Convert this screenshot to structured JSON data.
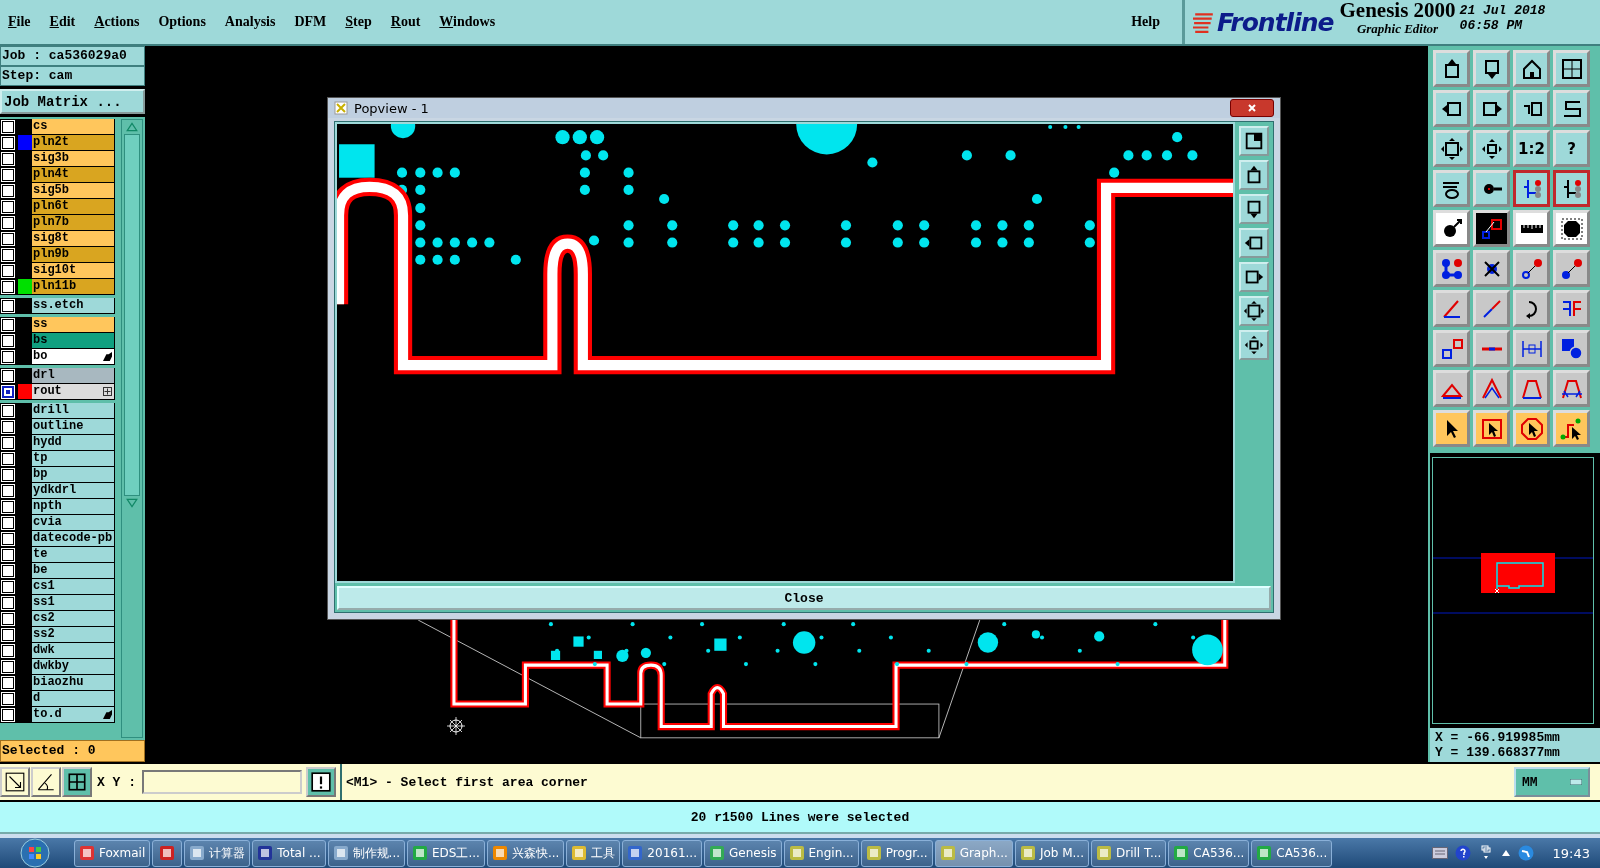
{
  "menu": [
    {
      "label": "File",
      "mnemonic": true
    },
    {
      "label": "Edit",
      "mnemonic": true
    },
    {
      "label": "Actions",
      "mnemonic": true
    },
    {
      "label": "Options",
      "mnemonic": false
    },
    {
      "label": "Analysis",
      "mnemonic": false
    },
    {
      "label": "DFM",
      "mnemonic": false
    },
    {
      "label": "Step",
      "mnemonic": true
    },
    {
      "label": "Rout",
      "mnemonic": true
    },
    {
      "label": "Windows",
      "mnemonic": true
    }
  ],
  "help": "Help",
  "logo": {
    "brand": "Frontline",
    "product": "Genesis 2000",
    "subtitle": "Graphic Editor",
    "date": "21 Jul 2018",
    "time": "06:58 PM"
  },
  "job": "Job : ca536029a0",
  "step": "Step: cam",
  "job_matrix": "Job Matrix ...",
  "layer_groups": [
    [
      {
        "name": "cs",
        "kind": "signal",
        "selected": false,
        "flagged": false,
        "expandable": false
      },
      {
        "name": "pln2t",
        "kind": "plane",
        "color": "#0000ff",
        "selected": false,
        "flagged": false,
        "expandable": false
      },
      {
        "name": "sig3b",
        "kind": "signal",
        "selected": false,
        "flagged": false,
        "expandable": false
      },
      {
        "name": "pln4t",
        "kind": "plane",
        "selected": false,
        "flagged": false,
        "expandable": false
      },
      {
        "name": "sig5b",
        "kind": "signal",
        "selected": false,
        "flagged": false,
        "expandable": false
      },
      {
        "name": "pln6t",
        "kind": "plane",
        "selected": false,
        "flagged": false,
        "expandable": false
      },
      {
        "name": "pln7b",
        "kind": "plane",
        "selected": false,
        "flagged": false,
        "expandable": false
      },
      {
        "name": "sig8t",
        "kind": "signal",
        "selected": false,
        "flagged": false,
        "expandable": false
      },
      {
        "name": "pln9b",
        "kind": "plane",
        "selected": false,
        "flagged": false,
        "expandable": false
      },
      {
        "name": "sig10t",
        "kind": "signal",
        "selected": false,
        "flagged": false,
        "expandable": false
      },
      {
        "name": "pln11b",
        "kind": "plane",
        "color": "#00e000",
        "selected": false,
        "flagged": false,
        "expandable": false
      }
    ],
    [
      {
        "name": "ss.etch",
        "kind": "document",
        "selected": false,
        "flagged": false,
        "expandable": false
      }
    ],
    [
      {
        "name": "ss",
        "kind": "signal",
        "selected": false,
        "flagged": false,
        "expandable": false
      },
      {
        "name": "bs",
        "kind": "mask",
        "selected": false,
        "flagged": false,
        "expandable": false
      },
      {
        "name": "bo",
        "kind": "board",
        "selected": false,
        "flagged": true,
        "expandable": false
      }
    ],
    [
      {
        "name": "drl",
        "kind": "drill",
        "selected": false,
        "flagged": false,
        "expandable": false
      },
      {
        "name": "rout",
        "kind": "rout",
        "color": "#ff0000",
        "selected": true,
        "flagged": false,
        "expandable": true
      }
    ],
    [
      {
        "name": "drill",
        "kind": "document",
        "selected": false,
        "flagged": false,
        "expandable": false
      },
      {
        "name": "outline",
        "kind": "document",
        "selected": false,
        "flagged": false,
        "expandable": false
      },
      {
        "name": "hydd",
        "kind": "document",
        "selected": false,
        "flagged": false,
        "expandable": false
      },
      {
        "name": "tp",
        "kind": "document",
        "selected": false,
        "flagged": false,
        "expandable": false
      },
      {
        "name": "bp",
        "kind": "document",
        "selected": false,
        "flagged": false,
        "expandable": false
      },
      {
        "name": "ydkdrl",
        "kind": "document",
        "selected": false,
        "flagged": false,
        "expandable": false
      },
      {
        "name": "npth",
        "kind": "document",
        "selected": false,
        "flagged": false,
        "expandable": false
      },
      {
        "name": "cvia",
        "kind": "document",
        "selected": false,
        "flagged": false,
        "expandable": false
      },
      {
        "name": "datecode-pb",
        "kind": "document",
        "selected": false,
        "flagged": false,
        "expandable": false
      },
      {
        "name": "te",
        "kind": "document",
        "selected": false,
        "flagged": false,
        "expandable": false
      },
      {
        "name": "be",
        "kind": "document",
        "selected": false,
        "flagged": false,
        "expandable": false
      },
      {
        "name": "cs1",
        "kind": "document",
        "selected": false,
        "flagged": false,
        "expandable": false
      },
      {
        "name": "ss1",
        "kind": "document",
        "selected": false,
        "flagged": false,
        "expandable": false
      },
      {
        "name": "cs2",
        "kind": "document",
        "selected": false,
        "flagged": false,
        "expandable": false
      },
      {
        "name": "ss2",
        "kind": "document",
        "selected": false,
        "flagged": false,
        "expandable": false
      },
      {
        "name": "dwk",
        "kind": "document",
        "selected": false,
        "flagged": false,
        "expandable": false
      },
      {
        "name": "dwkby",
        "kind": "document",
        "selected": false,
        "flagged": false,
        "expandable": false
      },
      {
        "name": "biaozhu",
        "kind": "document",
        "selected": false,
        "flagged": false,
        "expandable": false
      },
      {
        "name": "d",
        "kind": "document",
        "selected": false,
        "flagged": false,
        "expandable": false
      },
      {
        "name": "to.d",
        "kind": "document",
        "selected": false,
        "flagged": true,
        "expandable": false
      }
    ]
  ],
  "selected_count": "Selected : 0",
  "tool_buttons": [
    {
      "kind": "view",
      "selected": false
    },
    {
      "kind": "view",
      "selected": false
    },
    {
      "kind": "view",
      "selected": false
    },
    {
      "kind": "view",
      "selected": false
    },
    {
      "kind": "view",
      "selected": false
    },
    {
      "kind": "view",
      "selected": false
    },
    {
      "kind": "view",
      "selected": false
    },
    {
      "kind": "view",
      "selected": false
    },
    {
      "kind": "view",
      "selected": false
    },
    {
      "kind": "view",
      "selected": false
    },
    {
      "kind": "view",
      "label": "1:2",
      "selected": false
    },
    {
      "kind": "view",
      "label": "?",
      "selected": false
    },
    {
      "kind": "view",
      "selected": false
    },
    {
      "kind": "view",
      "selected": false
    },
    {
      "kind": "view",
      "selected": true
    },
    {
      "kind": "view",
      "selected": true
    },
    {
      "kind": "display",
      "selected": false
    },
    {
      "kind": "dark",
      "selected": false
    },
    {
      "kind": "display",
      "selected": false
    },
    {
      "kind": "display",
      "selected": false
    },
    {
      "kind": "edit",
      "selected": false
    },
    {
      "kind": "edit",
      "selected": false
    },
    {
      "kind": "edit",
      "selected": false
    },
    {
      "kind": "edit",
      "selected": false
    },
    {
      "kind": "edit",
      "selected": false
    },
    {
      "kind": "edit",
      "selected": false
    },
    {
      "kind": "edit",
      "selected": false
    },
    {
      "kind": "edit",
      "selected": false
    },
    {
      "kind": "edit",
      "selected": false
    },
    {
      "kind": "edit",
      "selected": false
    },
    {
      "kind": "edit",
      "selected": false
    },
    {
      "kind": "edit",
      "selected": false
    },
    {
      "kind": "edit",
      "selected": false
    },
    {
      "kind": "edit",
      "selected": false
    },
    {
      "kind": "edit",
      "selected": false
    },
    {
      "kind": "edit",
      "selected": false
    },
    {
      "kind": "select",
      "selected": false
    },
    {
      "kind": "select",
      "selected": false
    },
    {
      "kind": "select",
      "selected": false
    },
    {
      "kind": "select",
      "selected": false
    }
  ],
  "coords": {
    "x": "X = -66.919985mm",
    "y": "Y = 139.668377mm"
  },
  "popup": {
    "title": "Popview - 1",
    "close_button": "Close"
  },
  "command": {
    "xy_label": "X Y :",
    "prompt": "<M1> - Select first area corner",
    "units": "MM"
  },
  "status": "20 r1500 Lines were selected",
  "taskbar": [
    {
      "label": "Foxmail",
      "selected": false
    },
    {
      "selected": false
    },
    {
      "label": "计算器",
      "selected": false
    },
    {
      "label": "Total ...",
      "selected": false
    },
    {
      "label": "制作规...",
      "selected": false
    },
    {
      "label": "EDS工...",
      "selected": false
    },
    {
      "label": "兴森快...",
      "selected": false
    },
    {
      "label": "工具",
      "selected": false
    },
    {
      "label": "20161...",
      "selected": false
    },
    {
      "label": "Genesis",
      "selected": false
    },
    {
      "label": "Engin...",
      "selected": false
    },
    {
      "label": "Progr...",
      "selected": false
    },
    {
      "label": "Graph...",
      "selected": true
    },
    {
      "label": "Job M...",
      "selected": false
    },
    {
      "label": "Drill T...",
      "selected": false
    },
    {
      "label": "CA536...",
      "selected": false
    },
    {
      "label": "CA536...",
      "selected": false
    }
  ],
  "clock": "19:43"
}
